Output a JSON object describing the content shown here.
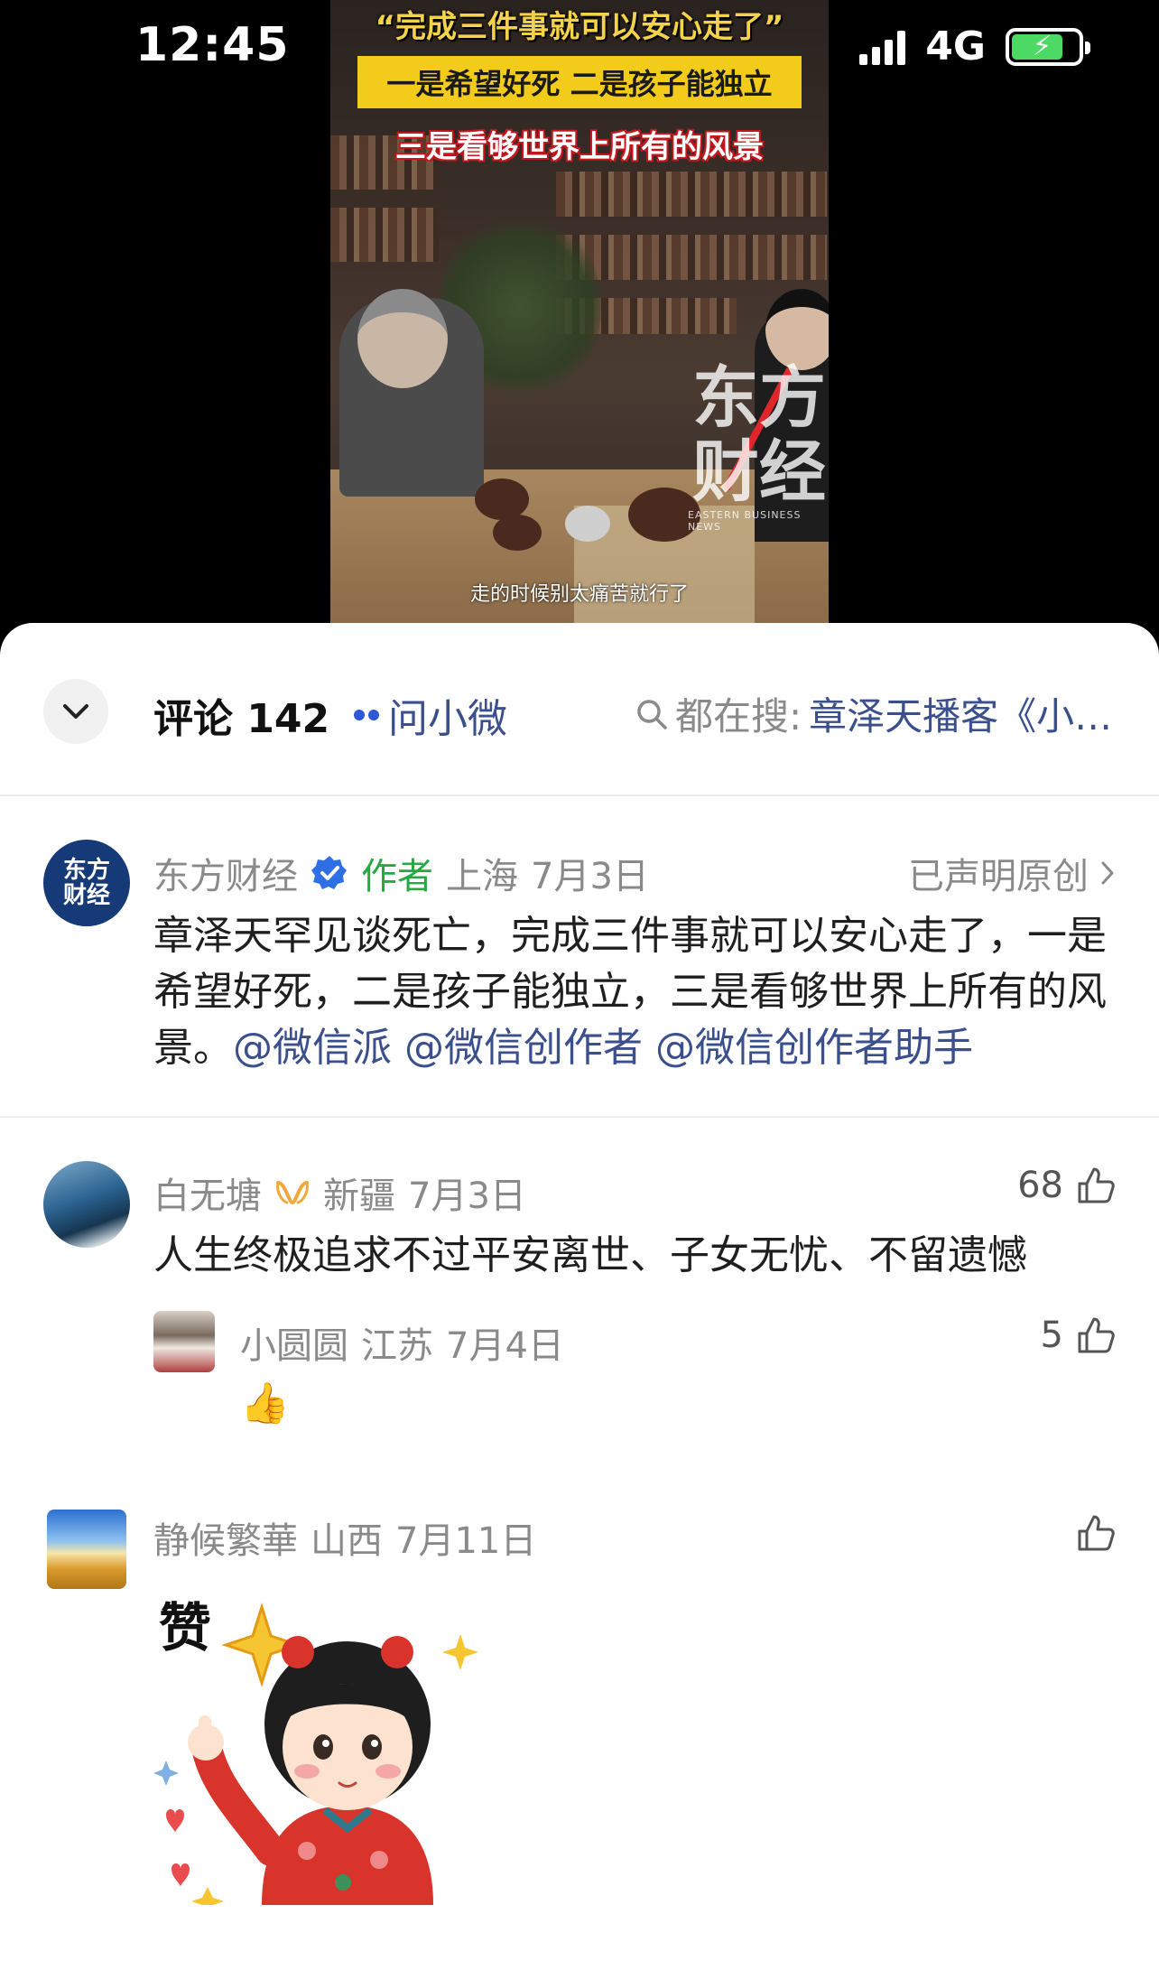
{
  "status_bar": {
    "time": "12:45",
    "network": "4G"
  },
  "video": {
    "caption_line1": "“完成三件事就可以安心走了”",
    "caption_line2": "一是希望好死 二是孩子能独立",
    "caption_line3": "三是看够世界上所有的风景",
    "watermark": "东方\n财经",
    "watermark_sub": "EASTERN BUSINESS NEWS",
    "subtitle": "走的时候别太痛苦就行了"
  },
  "header": {
    "comments_label": "评论 142",
    "ask_label": "问小微",
    "search_label": "都在搜:",
    "search_term": "章泽天播客《小…"
  },
  "post": {
    "author": "东方财经",
    "author_tag": "作者",
    "location": "上海",
    "date": "7月3日",
    "original_label": "已声明原创",
    "text": "章泽天罕见谈死亡，完成三件事就可以安心走了，一是希望好死，二是孩子能独立，三是看够世界上所有的风景。",
    "mentions": [
      "@微信派",
      "@微信创作者",
      "@微信创作者助手"
    ],
    "avatar_text": "东方\n财经"
  },
  "comments": [
    {
      "user": "白无塘",
      "location": "新疆",
      "date": "7月3日",
      "likes": "68",
      "text": "人生终极追求不过平安离世、子女无忧、不留遗憾",
      "reply": {
        "user": "小圆圆",
        "location": "江苏",
        "date": "7月4日",
        "likes": "5",
        "text": "👍"
      }
    },
    {
      "user": "静候繁華",
      "location": "山西",
      "date": "7月11日",
      "likes": "",
      "sticker_text": "赞"
    }
  ],
  "colors": {
    "link": "#3a4f8c",
    "author_green": "#27a844",
    "verified_blue": "#2f6fe6",
    "caption_yellow": "#f3cb1a",
    "caption_red": "#c4161c"
  }
}
